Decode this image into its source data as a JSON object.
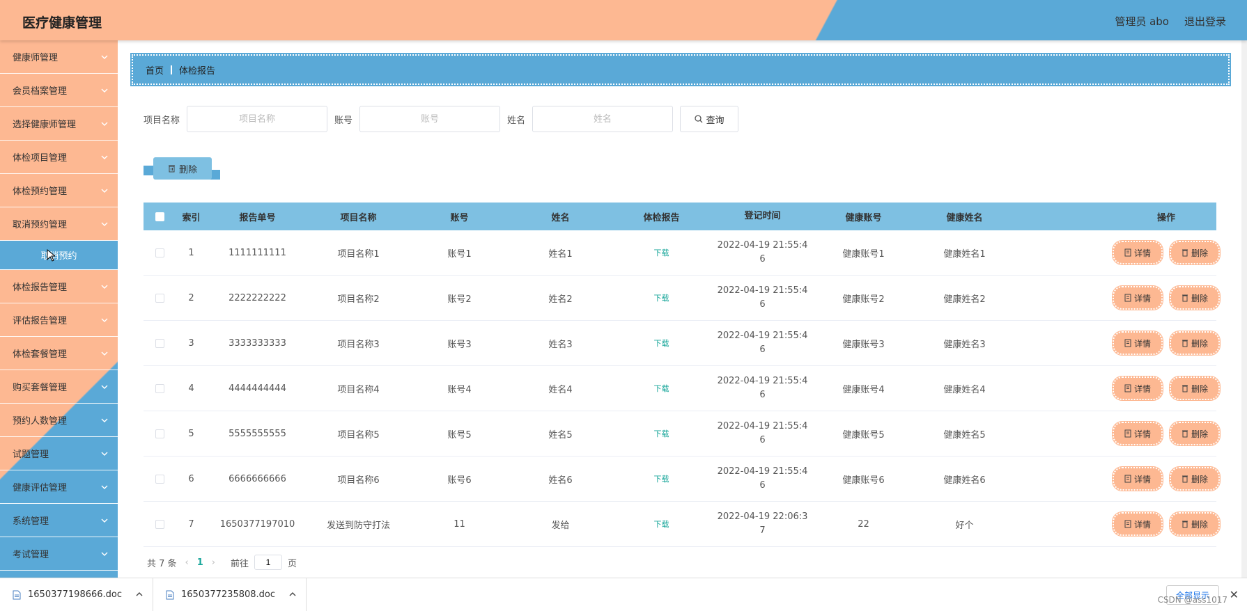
{
  "header": {
    "title": "医疗健康管理",
    "user": "管理员 abo",
    "logout": "退出登录"
  },
  "sidebar": {
    "items": [
      {
        "label": "健康师管理"
      },
      {
        "label": "会员档案管理"
      },
      {
        "label": "选择健康师管理"
      },
      {
        "label": "体检项目管理"
      },
      {
        "label": "体检预约管理"
      },
      {
        "label": "取消预约管理"
      },
      {
        "label": "取消预约",
        "sub": true
      },
      {
        "label": "体检报告管理"
      },
      {
        "label": "评估报告管理"
      },
      {
        "label": "体检套餐管理"
      },
      {
        "label": "购买套餐管理"
      },
      {
        "label": "预约人数管理"
      },
      {
        "label": "试题管理"
      },
      {
        "label": "健康评估管理"
      },
      {
        "label": "系统管理"
      },
      {
        "label": "考试管理"
      }
    ]
  },
  "breadcrumb": {
    "home": "首页",
    "current": "体检报告"
  },
  "search": {
    "project_label": "项目名称",
    "project_placeholder": "项目名称",
    "account_label": "账号",
    "account_placeholder": "账号",
    "name_label": "姓名",
    "name_placeholder": "姓名",
    "query_button": "查询"
  },
  "toolbar": {
    "delete_label": "删除"
  },
  "table": {
    "headers": [
      "索引",
      "报告单号",
      "项目名称",
      "账号",
      "姓名",
      "体检报告",
      "登记时间",
      "健康账号",
      "健康姓名",
      "操作"
    ],
    "rows": [
      {
        "idx": "1",
        "no": "1111111111",
        "proj": "项目名称1",
        "acc": "账号1",
        "name": "姓名1",
        "report": "下载",
        "time1": "2022-04-19 21:55:4",
        "time2": "6",
        "hacc": "健康账号1",
        "hname": "健康姓名1"
      },
      {
        "idx": "2",
        "no": "2222222222",
        "proj": "项目名称2",
        "acc": "账号2",
        "name": "姓名2",
        "report": "下载",
        "time1": "2022-04-19 21:55:4",
        "time2": "6",
        "hacc": "健康账号2",
        "hname": "健康姓名2"
      },
      {
        "idx": "3",
        "no": "3333333333",
        "proj": "项目名称3",
        "acc": "账号3",
        "name": "姓名3",
        "report": "下载",
        "time1": "2022-04-19 21:55:4",
        "time2": "6",
        "hacc": "健康账号3",
        "hname": "健康姓名3"
      },
      {
        "idx": "4",
        "no": "4444444444",
        "proj": "项目名称4",
        "acc": "账号4",
        "name": "姓名4",
        "report": "下载",
        "time1": "2022-04-19 21:55:4",
        "time2": "6",
        "hacc": "健康账号4",
        "hname": "健康姓名4"
      },
      {
        "idx": "5",
        "no": "5555555555",
        "proj": "项目名称5",
        "acc": "账号5",
        "name": "姓名5",
        "report": "下载",
        "time1": "2022-04-19 21:55:4",
        "time2": "6",
        "hacc": "健康账号5",
        "hname": "健康姓名5"
      },
      {
        "idx": "6",
        "no": "6666666666",
        "proj": "项目名称6",
        "acc": "账号6",
        "name": "姓名6",
        "report": "下载",
        "time1": "2022-04-19 21:55:4",
        "time2": "6",
        "hacc": "健康账号6",
        "hname": "健康姓名6"
      },
      {
        "idx": "7",
        "no": "1650377197010",
        "proj": "发送到防守打法",
        "acc": "11",
        "name": "发给",
        "report": "下载",
        "time1": "2022-04-19 22:06:3",
        "time2": "7",
        "hacc": "22",
        "hname": "好个"
      }
    ],
    "detail_label": "详情",
    "delete_label": "删除"
  },
  "pagination": {
    "total": "共 7 条",
    "current_page": "1",
    "goto_label": "前往",
    "goto_value": "1",
    "page_suffix": "页"
  },
  "downloads": {
    "items": [
      {
        "file": "1650377198666.doc"
      },
      {
        "file": "1650377235808.doc"
      }
    ],
    "show_all": "全部显示",
    "watermark": "CSDN @ass1017"
  },
  "colors": {
    "orange": "#fdb892",
    "blue": "#5aa9d7",
    "light_blue": "#7ec0e2",
    "link": "#1aa79b"
  }
}
